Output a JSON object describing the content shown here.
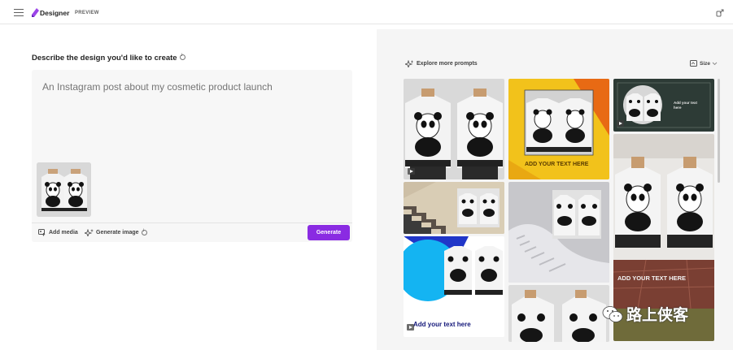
{
  "header": {
    "menu_icon": "hamburger-menu-icon",
    "app_name": "Designer",
    "badge": "PREVIEW",
    "share_icon": "share-icon"
  },
  "prompt": {
    "title": "Describe the design you'd like to create",
    "placeholder": "An Instagram post about my cosmetic product launch",
    "add_media": "Add media",
    "generate_image": "Generate image",
    "generate_button": "Generate",
    "accent_color": "#8a2be2"
  },
  "gallery": {
    "explore_label": "Explore more prompts",
    "size_label": "Size",
    "cards": [
      {
        "id": "panda-jackets-grey",
        "text": ""
      },
      {
        "id": "panda-jackets-yellow",
        "text": "ADD YOUR TEXT HERE"
      },
      {
        "id": "panda-jackets-dark",
        "text": "Add your text here"
      },
      {
        "id": "panda-jackets-stairs",
        "text": ""
      },
      {
        "id": "panda-jackets-spiral",
        "text": ""
      },
      {
        "id": "panda-jackets-tall",
        "text": "ADD YOUR TEXT HERE"
      },
      {
        "id": "panda-jackets-blue-circle",
        "text": "Add your text here"
      },
      {
        "id": "panda-jackets-bottom",
        "text": ""
      }
    ]
  },
  "watermark": {
    "text": "路上侠客"
  }
}
